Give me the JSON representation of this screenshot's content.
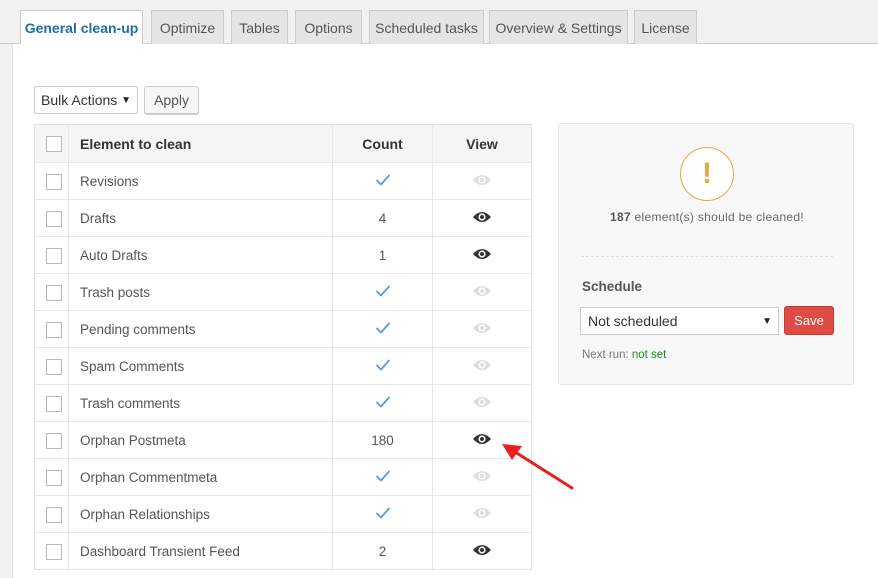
{
  "tabs": [
    {
      "label": "General clean-up",
      "active": true
    },
    {
      "label": "Optimize"
    },
    {
      "label": "Tables"
    },
    {
      "label": "Options"
    },
    {
      "label": "Scheduled tasks"
    },
    {
      "label": "Overview & Settings"
    },
    {
      "label": "License"
    }
  ],
  "toolbar": {
    "bulk_actions": "Bulk Actions",
    "apply": "Apply"
  },
  "table": {
    "headers": {
      "element": "Element to clean",
      "count": "Count",
      "view": "View"
    },
    "rows": [
      {
        "name": "Revisions",
        "count": "",
        "check": true,
        "eye_active": false
      },
      {
        "name": "Drafts",
        "count": "4",
        "check": false,
        "eye_active": true
      },
      {
        "name": "Auto Drafts",
        "count": "1",
        "check": false,
        "eye_active": true
      },
      {
        "name": "Trash posts",
        "count": "",
        "check": true,
        "eye_active": false
      },
      {
        "name": "Pending comments",
        "count": "",
        "check": true,
        "eye_active": false
      },
      {
        "name": "Spam Comments",
        "count": "",
        "check": true,
        "eye_active": false
      },
      {
        "name": "Trash comments",
        "count": "",
        "check": true,
        "eye_active": false
      },
      {
        "name": "Orphan Postmeta",
        "count": "180",
        "check": false,
        "eye_active": true
      },
      {
        "name": "Orphan Commentmeta",
        "count": "",
        "check": true,
        "eye_active": false
      },
      {
        "name": "Orphan Relationships",
        "count": "",
        "check": true,
        "eye_active": false
      },
      {
        "name": "Dashboard Transient Feed",
        "count": "2",
        "check": false,
        "eye_active": true
      }
    ]
  },
  "summary": {
    "alert_symbol": "!",
    "count": "187",
    "message": " element(s) should be cleaned!",
    "schedule_title": "Schedule",
    "schedule_value": "Not scheduled",
    "save": "Save",
    "next_run_label": "Next run: ",
    "next_run_value": "not set"
  },
  "colors": {
    "accent_blue": "#1d6fa5",
    "check_blue": "#5b9bd5",
    "save_red": "#e04c43",
    "alert_orange": "#e6a93a",
    "annotation_red": "#e8201c",
    "eye_active": "#333333",
    "eye_inactive": "#dddddd"
  }
}
